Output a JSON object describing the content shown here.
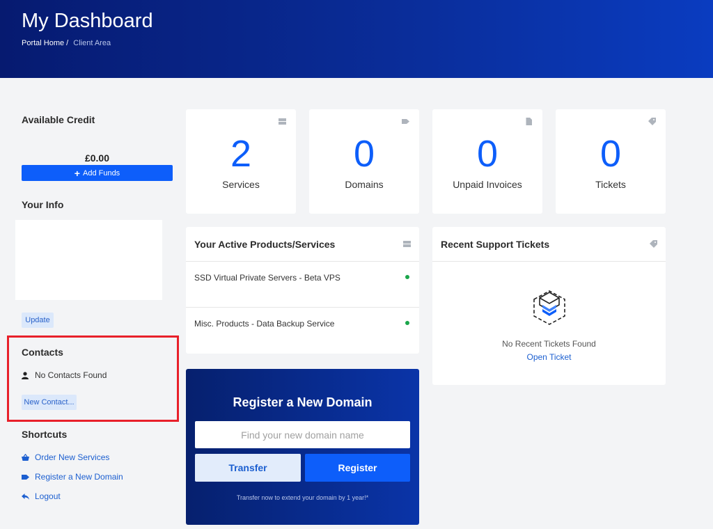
{
  "header": {
    "title": "My Dashboard",
    "breadcrumb": [
      "Portal Home",
      "Client Area"
    ]
  },
  "sidebar": {
    "credit": {
      "title": "Available Credit",
      "amount": "£0.00",
      "add_funds": "Add Funds"
    },
    "info": {
      "title": "Your Info",
      "update": "Update"
    },
    "contacts": {
      "title": "Contacts",
      "empty": "No Contacts Found",
      "new": "New Contact..."
    },
    "shortcuts": {
      "title": "Shortcuts",
      "items": [
        "Order New Services",
        "Register a New Domain",
        "Logout"
      ]
    }
  },
  "stats": [
    {
      "value": "2",
      "label": "Services",
      "icon": "server-icon"
    },
    {
      "value": "0",
      "label": "Domains",
      "icon": "tag-icon"
    },
    {
      "value": "0",
      "label": "Unpaid Invoices",
      "icon": "document-icon"
    },
    {
      "value": "0",
      "label": "Tickets",
      "icon": "ticket-icon"
    }
  ],
  "products": {
    "title": "Your Active Products/Services",
    "items": [
      "SSD Virtual Private Servers - Beta VPS",
      "Misc. Products - Data Backup Service"
    ]
  },
  "tickets": {
    "title": "Recent Support Tickets",
    "empty": "No Recent Tickets Found",
    "open": "Open Ticket"
  },
  "domain": {
    "title": "Register a New Domain",
    "placeholder": "Find your new domain name",
    "transfer": "Transfer",
    "register": "Register",
    "note": "Transfer now to extend your domain by 1 year!*"
  },
  "colors": {
    "accent": "#0d5efa",
    "header": "#0a2e9c",
    "highlight": "#e8202a",
    "status_active": "#1aa64a"
  }
}
